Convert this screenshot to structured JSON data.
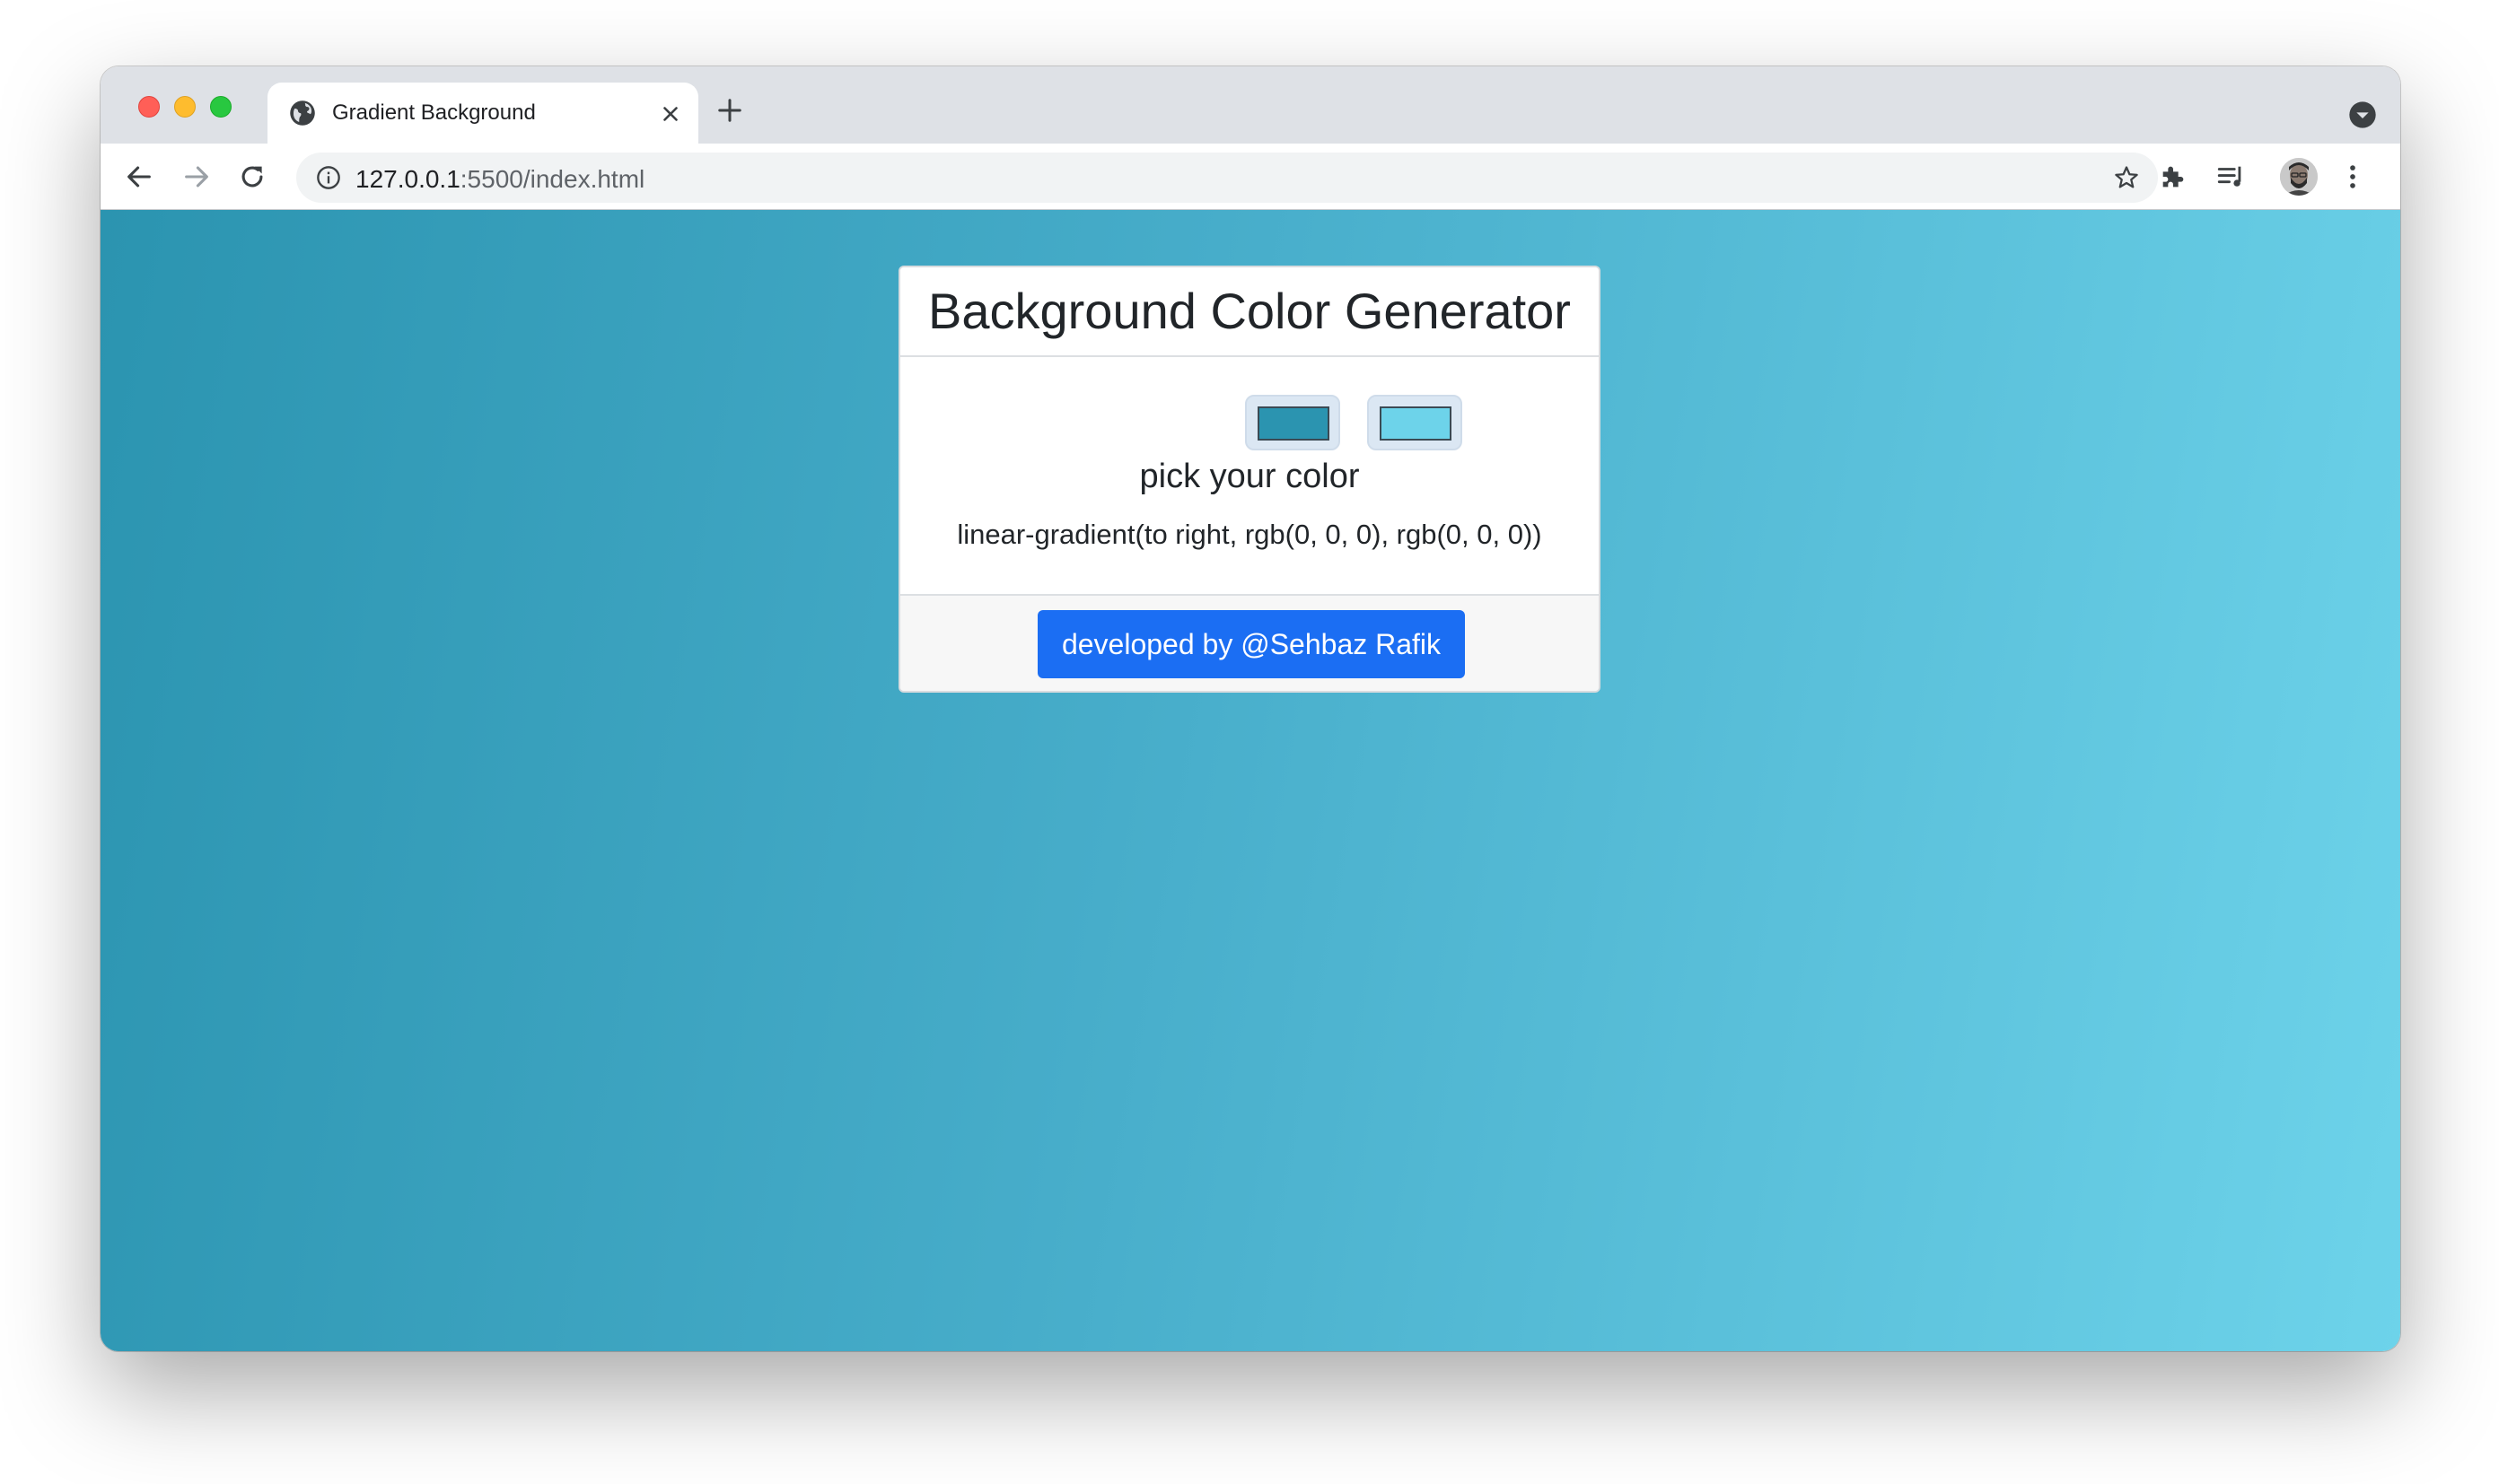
{
  "browser": {
    "tab_title": "Gradient Background",
    "url_host": "127.0.0.1",
    "url_rest": ":5500/index.html"
  },
  "icons": {
    "tab_favicon": "globe-icon",
    "tab_close": "close-icon",
    "new_tab": "plus-icon",
    "tab_search": "chevron-down-circle-icon",
    "back": "arrow-left-icon",
    "forward": "arrow-right-icon",
    "reload": "reload-icon",
    "site_info": "info-icon",
    "bookmark": "star-icon",
    "extensions": "puzzle-icon",
    "media": "playlist-icon",
    "profile": "avatar",
    "menu": "kebab-menu-icon"
  },
  "page": {
    "title": "Background Color Generator",
    "color1": "#2b94b0",
    "color2": "#6dd3ea",
    "pick_label": "pick your color",
    "gradient_text": "linear-gradient(to right, rgb(0, 0, 0), rgb(0, 0, 0))",
    "footer_button": "developed by @Sehbaz Rafik",
    "button_color": "#1b6ef3"
  }
}
